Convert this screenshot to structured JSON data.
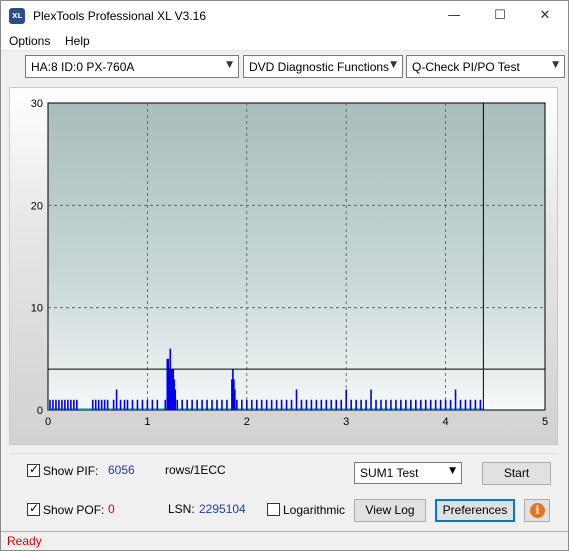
{
  "window": {
    "title": "PlexTools Professional XL V3.16",
    "icon_text": "XL"
  },
  "window_controls": {
    "minimize": "—",
    "maximize": "☐",
    "close": "✕"
  },
  "menu": {
    "options": "Options",
    "help": "Help"
  },
  "toolbar": {
    "drive": "HA:8 ID:0  PX-760A",
    "function": "DVD Diagnostic Functions",
    "test": "Q-Check PI/PO Test"
  },
  "chart_data": {
    "type": "bar",
    "x_ticks": [
      "0",
      "1",
      "2",
      "3",
      "4",
      "5"
    ],
    "y_ticks": [
      "0",
      "10",
      "20",
      "30"
    ],
    "xlim": [
      0,
      5
    ],
    "ylim": [
      0,
      30
    ],
    "threshold": 4,
    "end_marker_x": 4.38,
    "grid": true,
    "background_color": "#a8bdbd",
    "bar_color": "#0000ee",
    "series": [
      {
        "x": [
          0.02,
          0.05,
          0.08,
          0.11,
          0.14,
          0.17,
          0.2,
          0.23,
          0.26,
          0.29,
          0.45,
          0.48,
          0.51,
          0.54,
          0.57,
          0.6,
          0.66,
          0.69,
          0.73,
          0.77,
          0.8,
          0.85,
          0.9,
          0.95,
          1.0,
          1.05,
          1.1,
          1.18,
          1.2,
          1.21,
          1.22,
          1.23,
          1.24,
          1.25,
          1.26,
          1.27,
          1.28,
          1.3,
          1.35,
          1.4,
          1.45,
          1.5,
          1.55,
          1.6,
          1.65,
          1.7,
          1.75,
          1.8,
          1.85,
          1.86,
          1.87,
          1.88,
          1.9,
          1.95,
          2.0,
          2.05,
          2.1,
          2.15,
          2.2,
          2.25,
          2.3,
          2.35,
          2.4,
          2.45,
          2.5,
          2.55,
          2.6,
          2.65,
          2.7,
          2.75,
          2.8,
          2.85,
          2.9,
          2.95,
          3.0,
          3.05,
          3.1,
          3.15,
          3.2,
          3.25,
          3.3,
          3.35,
          3.4,
          3.45,
          3.5,
          3.55,
          3.6,
          3.65,
          3.7,
          3.75,
          3.8,
          3.85,
          3.9,
          3.95,
          4.0,
          4.05,
          4.1,
          4.15,
          4.2,
          4.25,
          4.3,
          4.35
        ],
        "values": [
          1,
          1,
          1,
          1,
          1,
          1,
          1,
          1,
          1,
          1,
          1,
          1,
          1,
          1,
          1,
          1,
          1,
          2,
          1,
          1,
          1,
          1,
          1,
          1,
          1,
          1,
          1,
          1,
          5,
          5,
          4,
          6,
          4,
          4,
          4,
          3,
          2,
          1,
          1,
          1,
          1,
          1,
          1,
          1,
          1,
          1,
          1,
          1,
          3,
          4,
          3,
          2,
          1,
          1,
          1,
          1,
          1,
          1,
          1,
          1,
          1,
          1,
          1,
          1,
          2,
          1,
          1,
          1,
          1,
          1,
          1,
          1,
          1,
          1,
          2,
          1,
          1,
          1,
          1,
          2,
          1,
          1,
          1,
          1,
          1,
          1,
          1,
          1,
          1,
          1,
          1,
          1,
          1,
          1,
          1,
          1,
          2,
          1,
          1,
          1,
          1,
          1
        ]
      }
    ]
  },
  "controls": {
    "show_pif_label": "Show PIF:",
    "pif_value": "6056",
    "rows_label": "rows/1ECC",
    "show_pof_label": "Show POF:",
    "pof_value": "0",
    "lsn_label": "LSN:",
    "lsn_value": "2295104",
    "logarithmic_label": "Logarithmic",
    "sum_select": "SUM1 Test",
    "start_button": "Start",
    "view_log_button": "View Log",
    "preferences_button": "Preferences",
    "info_glyph": "i"
  },
  "status": {
    "text": "Ready"
  }
}
